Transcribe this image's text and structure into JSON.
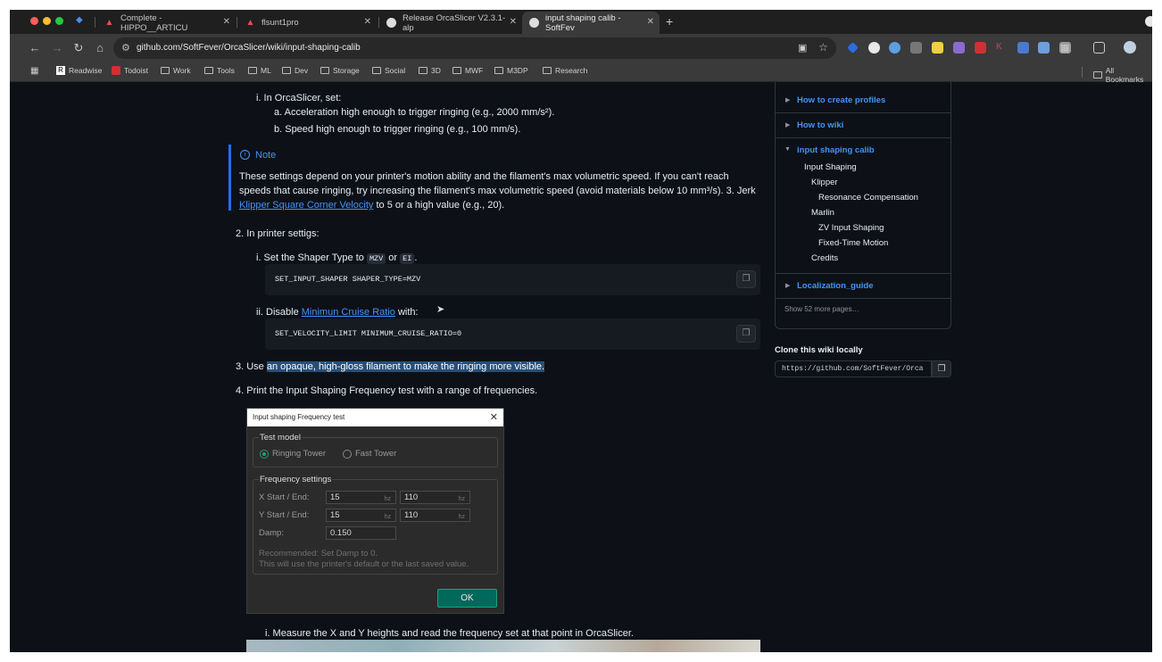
{
  "browser": {
    "tabs": [
      {
        "title": "Complete - HIPPO__ARTICU",
        "active": false
      },
      {
        "title": "flsunt1pro",
        "active": false
      },
      {
        "title": "Release OrcaSlicer V2.3.1-alp",
        "active": false
      },
      {
        "title": "input shaping calib - SoftFev",
        "active": true
      }
    ],
    "new_tab": "+",
    "url": "github.com/SoftFever/OrcaSlicer/wiki/input-shaping-calib",
    "bookmarks": [
      "Readwise",
      "Todoist",
      "Work",
      "Tools",
      "ML",
      "Dev",
      "Storage",
      "Social",
      "3D",
      "MWF",
      "M3DP",
      "Research"
    ],
    "all_bookmarks": "All Bookmarks"
  },
  "content": {
    "step_i_orca": "i. In OrcaSlicer, set:",
    "step_a": "a. Acceleration high enough to trigger ringing (e.g., 2000 mm/s²).",
    "step_b": "b. Speed high enough to trigger ringing (e.g., 100 mm/s).",
    "note_title": "Note",
    "note_line1": "These settings depend on your printer's motion ability and the filament's max volumetric speed. If you can't reach",
    "note_line2": "speeds that cause ringing, try increasing the filament's max volumetric speed (avoid materials below 10 mm³/s). 3. Jerk",
    "note_link": "Klipper Square Corner Velocity",
    "note_line3_rest": " to 5 or a high value (e.g., 20).",
    "step2": "2. In printer settigs:",
    "step2_i_pre": "i. Set the Shaper Type to ",
    "code_mzv": "MZV",
    "or": " or ",
    "code_ei": "EI",
    "dot": ".",
    "code1": "SET_INPUT_SHAPER SHAPER_TYPE=MZV",
    "step2_ii_pre": "ii. Disable ",
    "step2_ii_link": "Minimun Cruise Ratio",
    "step2_ii_post": " with:",
    "code2": "SET_VELOCITY_LIMIT MINIMUM_CRUISE_RATIO=0",
    "step3_pre": "3. Use ",
    "step3_hl": "an opaque, high-gloss filament to make the ringing more visible.",
    "step4": "4. Print the Input Shaping Frequency test with a range of frequencies.",
    "measure": "i. Measure the X and Y heights and read the frequency set at that point in OrcaSlicer."
  },
  "dialog": {
    "title": "Input shaping Frequency test",
    "test_model": "Test model",
    "ringing_tower": "Ringing Tower",
    "fast_tower": "Fast Tower",
    "freq_settings": "Frequency settings",
    "x_label": "X Start / End:",
    "y_label": "Y Start / End:",
    "damp_label": "Damp:",
    "x_start": "15",
    "x_end": "110",
    "y_start": "15",
    "y_end": "110",
    "damp": "0.150",
    "unit": "hz",
    "rec1": "Recommended: Set Damp to 0.",
    "rec2": "This will use the printer's default or the last saved value.",
    "ok": "OK"
  },
  "sidebar": {
    "how_profiles": "How to create profiles",
    "how_wiki": "How to wiki",
    "current": "input shaping calib",
    "sub": [
      "Input Shaping",
      "Klipper",
      "Resonance Compensation",
      "Marlin",
      "ZV Input Shaping",
      "Fixed-Time Motion",
      "Credits"
    ],
    "localization": "Localization_guide",
    "more": "Show 52 more pages…",
    "clone_title": "Clone this wiki locally",
    "clone_url": "https://github.com/SoftFever/Orca"
  },
  "colors": {
    "accent": "#4493f8",
    "ok_button": "#00695c",
    "note_border": "#1f6feb",
    "highlight": "#264f78"
  }
}
